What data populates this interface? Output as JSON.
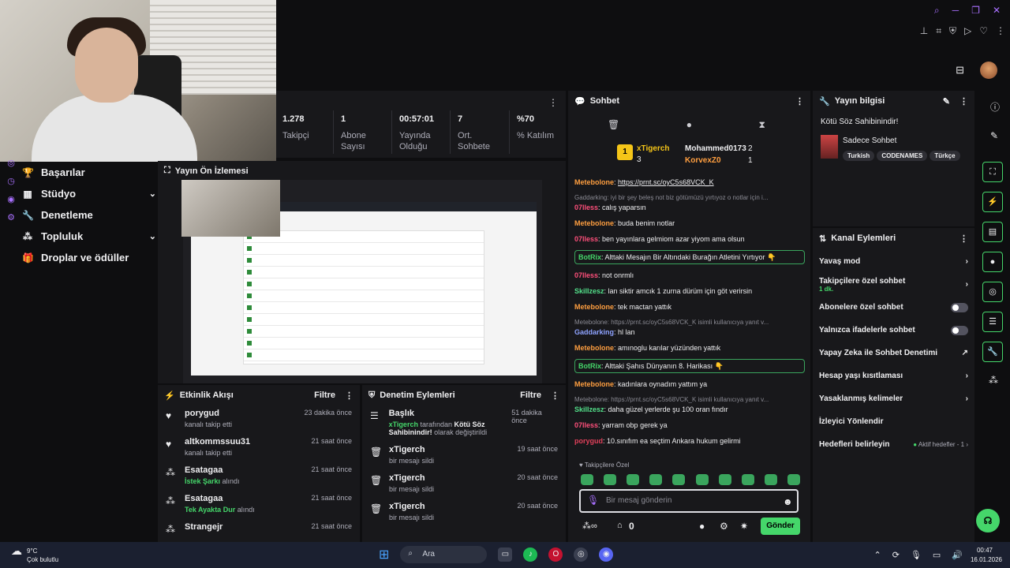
{
  "stats": [
    {
      "value": "1.278",
      "label": "Takipçi"
    },
    {
      "value": "1",
      "label": "Abone Sayısı"
    },
    {
      "value": "00:57:01",
      "label": "Yayında Olduğu"
    },
    {
      "value": "7",
      "label": "Ort. Sohbete"
    },
    {
      "value": "%70",
      "label": "% Katılım"
    }
  ],
  "nav": [
    {
      "icon": "trophy-icon",
      "glyph": "🏆",
      "label": "Başarılar",
      "chev": ""
    },
    {
      "icon": "studio-icon",
      "glyph": "▦",
      "label": "Stüdyo",
      "chev": "⌄"
    },
    {
      "icon": "wrench-icon",
      "glyph": "🔧",
      "label": "Denetleme",
      "chev": ""
    },
    {
      "icon": "community-icon",
      "glyph": "⁂",
      "label": "Topluluk",
      "chev": "⌄"
    },
    {
      "icon": "gift-icon",
      "glyph": "🎁",
      "label": "Droplar ve ödüller",
      "chev": ""
    }
  ],
  "preview": {
    "title": "Yayın Ön İzlemesi"
  },
  "activity": {
    "title": "Etkinlik Akışı",
    "filter": "Filtre",
    "items": [
      {
        "name": "porygud",
        "sub": "kanalı takip etti",
        "hl": "",
        "time": "23 dakika önce",
        "icon": "♥"
      },
      {
        "name": "altkommssuu31",
        "sub": "kanalı takip etti",
        "hl": "",
        "time": "21 saat önce",
        "icon": "♥"
      },
      {
        "name": "Esatagaa",
        "hl": "İstek Şarkı",
        "sub": " alındı",
        "time": "21 saat önce",
        "icon": "⁂"
      },
      {
        "name": "Esatagaa",
        "hl": "Tek Ayakta Dur",
        "sub": " alındı",
        "time": "21 saat önce",
        "icon": "⁂"
      },
      {
        "name": "Strangejr",
        "hl": "",
        "sub": "",
        "time": "21 saat önce",
        "icon": "⁂"
      }
    ]
  },
  "moderation": {
    "title": "Denetim Eylemleri",
    "filter": "Filtre",
    "items": [
      {
        "name": "Başlık",
        "hl": "xTigerch",
        "sub": " tarafından ",
        "bold": "Kötü Söz Sahibinindir!",
        "sub2": " olarak değiştirildi",
        "time": "51 dakika önce"
      },
      {
        "name": "xTigerch",
        "hl": "",
        "sub": "bir mesajı sildi",
        "bold": "",
        "sub2": "",
        "time": "19 saat önce"
      },
      {
        "name": "xTigerch",
        "hl": "",
        "sub": "bir mesajı sildi",
        "bold": "",
        "sub2": "",
        "time": "20 saat önce"
      },
      {
        "name": "xTigerch",
        "hl": "",
        "sub": "bir mesajı sildi",
        "bold": "",
        "sub2": "",
        "time": "20 saat önce"
      }
    ]
  },
  "chat": {
    "title": "Sohbet",
    "top": [
      {
        "rank": "1",
        "name": "xTigerch",
        "count": "3"
      },
      {
        "name": "Mohammed0173",
        "count": "2"
      },
      {
        "name": "KorvexZ0",
        "count": "1"
      }
    ],
    "messages": [
      {
        "type": "msg",
        "user": "Metebolone",
        "color": "#ff9f40",
        "text": "https://prnt.sc/oyC5s68VCK_K"
      },
      {
        "type": "reply",
        "text": "Gaddarking: iyi bir şey beleş not biz götümüzü yırtıyoz o notlar için i..."
      },
      {
        "type": "msg",
        "user": "07lless",
        "color": "#ff4f7b",
        "text": "calış yaparsın"
      },
      {
        "type": "msg",
        "user": "Metebolone",
        "color": "#ff9f40",
        "text": "buda benim notlar"
      },
      {
        "type": "msg",
        "user": "07lless",
        "color": "#ff4f7b",
        "text": "ben yayınlara gelmiom azar yiyom ama olsun"
      },
      {
        "type": "bot",
        "user": "BotRix",
        "text": "Alttaki Mesajın Bir Altındaki Burağın Atletini Yırtıyor 👇"
      },
      {
        "type": "msg",
        "user": "07lless",
        "color": "#ff4f7b",
        "text": "not onrmlı"
      },
      {
        "type": "msg",
        "user": "Skillzesz",
        "color": "#53e08a",
        "text": "lan siktir amcık 1 zurna dürüm için göt verirsin"
      },
      {
        "type": "msg",
        "user": "Metebolone",
        "color": "#ff9f40",
        "text": "tek mactan yattık"
      },
      {
        "type": "reply",
        "text": "Metebolone: https://prnt.sc/oyC5s68VCK_K isimli kullanıcıya yanıt v..."
      },
      {
        "type": "msg",
        "user": "Gaddarking",
        "color": "#8fa3ff",
        "text": "hl lan"
      },
      {
        "type": "msg",
        "user": "Metebolone",
        "color": "#ff9f40",
        "text": "amınoglu karılar yüzünden yattık"
      },
      {
        "type": "bot",
        "user": "BotRix",
        "text": "Alttaki Şahıs Dünyanın 8. Harikası 👇"
      },
      {
        "type": "msg",
        "user": "Metebolone",
        "color": "#ff9f40",
        "text": "kadınlara oynadım yattım ya"
      },
      {
        "type": "reply",
        "text": "Metebolone: https://prnt.sc/oyC5s68VCK_K isimli kullanıcıya yanıt v..."
      },
      {
        "type": "msg",
        "user": "Skillzesz",
        "color": "#53e08a",
        "text": "daha güzel yerlerde şu 100 oran fındır"
      },
      {
        "type": "msg",
        "user": "07lless",
        "color": "#ff4f7b",
        "text": "yarram obp gerek ya"
      },
      {
        "type": "msg",
        "user": "porygud",
        "color": "#e0405a",
        "text": "10.sınıfım ea seçtim Ankara hukum gelirmi"
      }
    ],
    "followers_only": "Takipçilere Özel",
    "placeholder": "Bir mesaj gönderin",
    "send": "Gönder",
    "count": "0"
  },
  "info": {
    "title": "Yayın bilgisi",
    "stream_title": "Kötü Söz Sahibinindir!",
    "category": "Sadece Sohbet",
    "tags": [
      "Turkish",
      "CODENAMES",
      "Türkçe"
    ]
  },
  "actions": {
    "title": "Kanal Eylemleri",
    "items": [
      {
        "label": "Yavaş mod",
        "sub": "",
        "ctl": "chev"
      },
      {
        "label": "Takipçilere özel sohbet",
        "sub": "1 dk.",
        "ctl": "chev"
      },
      {
        "label": "Abonelere özel sohbet",
        "sub": "",
        "ctl": "toggle"
      },
      {
        "label": "Yalnızca ifadelerle sohbet",
        "sub": "",
        "ctl": "toggle"
      },
      {
        "label": "Yapay Zeka ile Sohbet Denetimi",
        "sub": "",
        "ctl": "ext"
      },
      {
        "label": "Hesap yaşı kısıtlaması",
        "sub": "",
        "ctl": "chev"
      },
      {
        "label": "Yasaklanmış kelimeler",
        "sub": "",
        "ctl": "chev"
      },
      {
        "label": "İzleyici Yönlendir",
        "sub": "",
        "ctl": ""
      },
      {
        "label": "Hedefleri belirleyin",
        "sub": "",
        "ctl": "goal"
      }
    ],
    "goal_text": "Aktif hedefler - 1"
  },
  "taskbar": {
    "temp": "9°C",
    "weather": "Çok bulutlu",
    "search": "Ara",
    "time": "00:47",
    "date": "16.01.2026"
  },
  "colors": {
    "accent": "#45d66a",
    "bg": "#0e0e10",
    "panel": "#18181b"
  }
}
